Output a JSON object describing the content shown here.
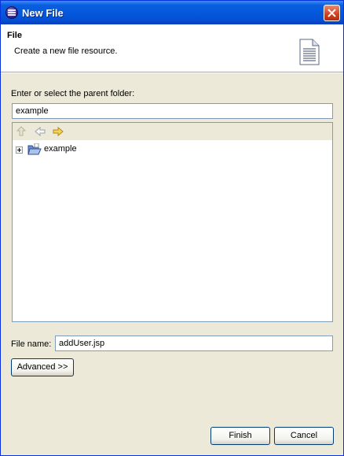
{
  "window": {
    "title": "New File"
  },
  "header": {
    "title": "File",
    "description": "Create a new file resource."
  },
  "parent_folder": {
    "label": "Enter or select the parent folder:",
    "value": "example"
  },
  "tree": {
    "toolbar": [
      "go-up-icon",
      "back-arrow-icon",
      "forward-arrow-icon"
    ],
    "items": [
      {
        "label": "example",
        "icon": "open-folder-icon",
        "expanded": false
      }
    ]
  },
  "file_name": {
    "label": "File name:",
    "value": "addUser.jsp"
  },
  "buttons": {
    "advanced": "Advanced >>",
    "finish": "Finish",
    "cancel": "Cancel"
  },
  "colors": {
    "titlebar": "#0458dc",
    "dialog_bg": "#ece9d8",
    "close_button": "#d0401e"
  }
}
